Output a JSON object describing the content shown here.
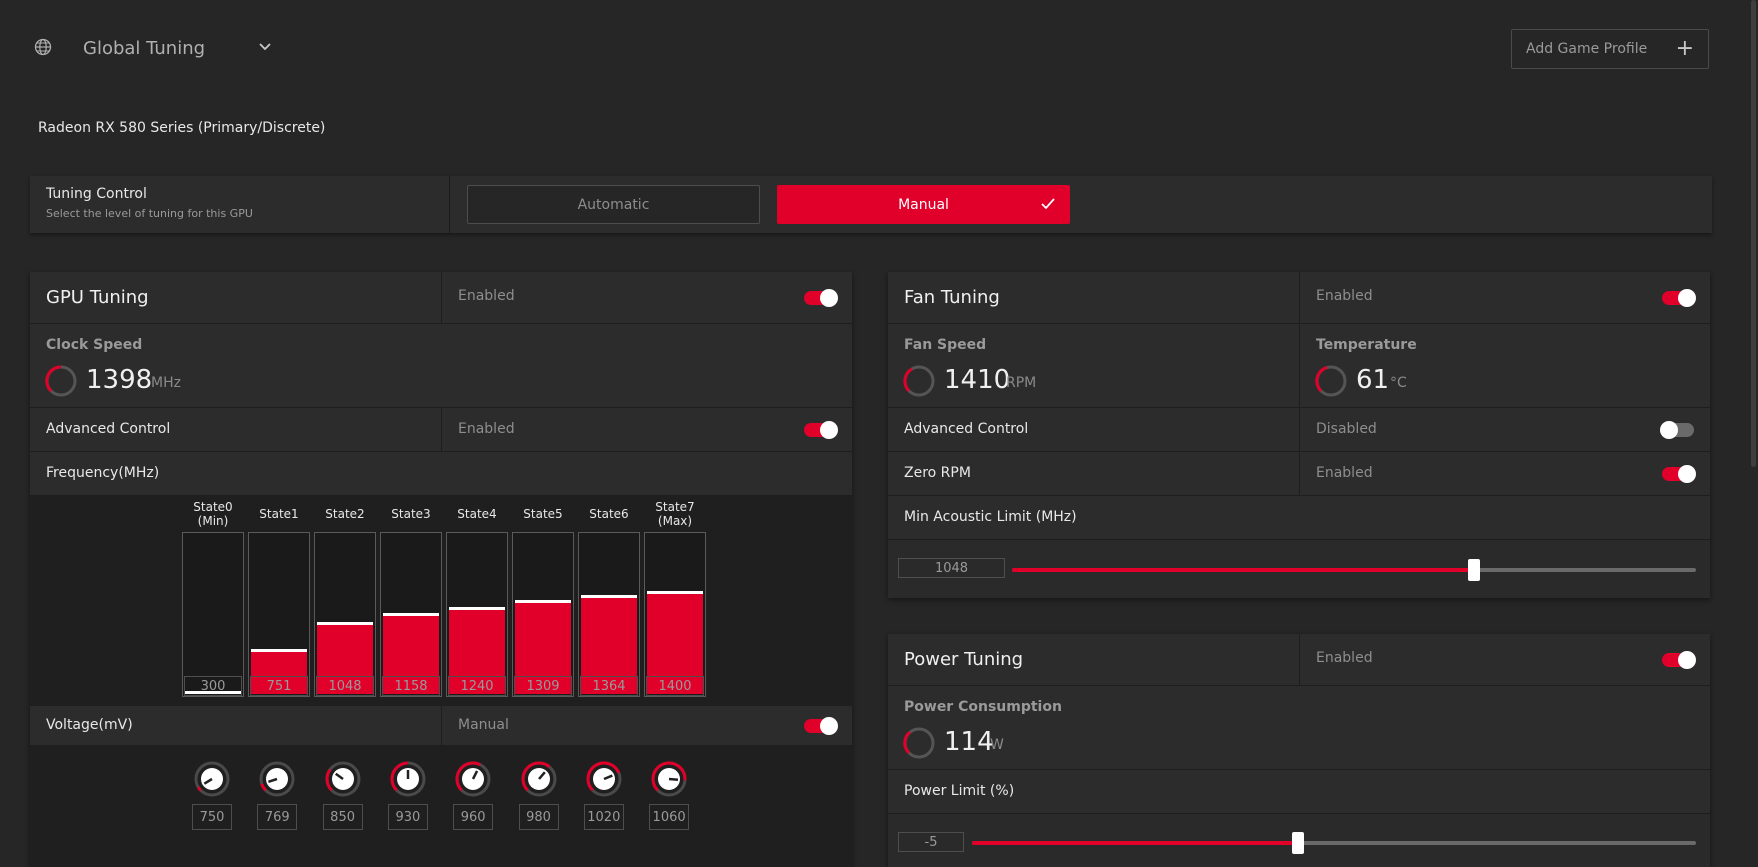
{
  "header": {
    "title": "Global Tuning",
    "add_profile": "Add Game Profile",
    "gpu_name": "Radeon RX 580 Series (Primary/Discrete)"
  },
  "tuning_control": {
    "title": "Tuning Control",
    "subtitle": "Select the level of tuning for this GPU",
    "automatic": "Automatic",
    "manual": "Manual"
  },
  "gpu_tuning": {
    "title": "GPU Tuning",
    "state": "Enabled",
    "clock_label": "Clock Speed",
    "clock_value": "1398",
    "clock_unit": "MHz",
    "advanced_label": "Advanced Control",
    "advanced_state": "Enabled",
    "frequency_label": "Frequency(MHz)",
    "voltage_label": "Voltage(mV)",
    "voltage_state": "Manual",
    "bars": [
      {
        "label": "State0",
        "sub": "(Min)",
        "value": "300",
        "fill": 0.02
      },
      {
        "label": "State1",
        "sub": "",
        "value": "751",
        "fill": 0.28
      },
      {
        "label": "State2",
        "sub": "",
        "value": "1048",
        "fill": 0.45
      },
      {
        "label": "State3",
        "sub": "",
        "value": "1158",
        "fill": 0.51
      },
      {
        "label": "State4",
        "sub": "",
        "value": "1240",
        "fill": 0.55
      },
      {
        "label": "State5",
        "sub": "",
        "value": "1309",
        "fill": 0.59
      },
      {
        "label": "State6",
        "sub": "",
        "value": "1364",
        "fill": 0.62
      },
      {
        "label": "State7",
        "sub": "(Max)",
        "value": "1400",
        "fill": 0.65
      }
    ],
    "voltages": [
      {
        "value": "750",
        "level": 0.05
      },
      {
        "value": "769",
        "level": 0.1
      },
      {
        "value": "850",
        "level": 0.3
      },
      {
        "value": "930",
        "level": 0.5
      },
      {
        "value": "960",
        "level": 0.6
      },
      {
        "value": "980",
        "level": 0.65
      },
      {
        "value": "1020",
        "level": 0.75
      },
      {
        "value": "1060",
        "level": 0.85
      }
    ]
  },
  "fan_tuning": {
    "title": "Fan Tuning",
    "state": "Enabled",
    "fan_label": "Fan Speed",
    "fan_value": "1410",
    "fan_unit": "RPM",
    "temp_label": "Temperature",
    "temp_value": "61",
    "temp_unit": "°C",
    "advanced_label": "Advanced Control",
    "advanced_state": "Disabled",
    "zero_label": "Zero RPM",
    "zero_state": "Enabled",
    "acoustic_label": "Min Acoustic Limit (MHz)",
    "acoustic_value": "1048",
    "acoustic_level": 0.675
  },
  "power_tuning": {
    "title": "Power Tuning",
    "state": "Enabled",
    "consumption_label": "Power Consumption",
    "consumption_value": "114",
    "consumption_unit": "W",
    "limit_label": "Power Limit (%)",
    "limit_value": "-5",
    "limit_level": 0.45
  },
  "colors": {
    "accent": "#e0002a",
    "bg": "#262626",
    "panel": "#2c2c2c"
  }
}
